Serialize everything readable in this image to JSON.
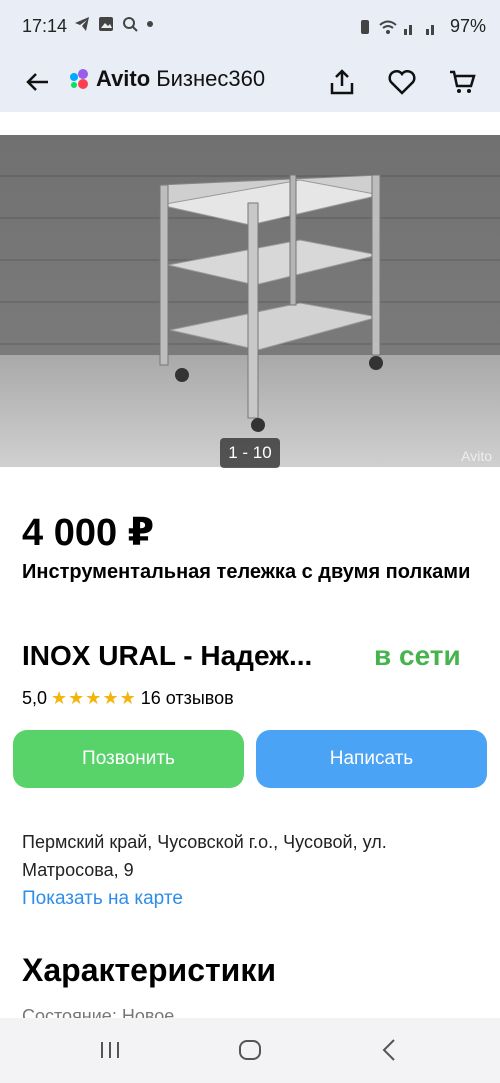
{
  "status": {
    "time": "17:14",
    "battery": "97%"
  },
  "header": {
    "brand_primary": "Avito",
    "brand_secondary": "Бизнес360"
  },
  "gallery": {
    "counter": "1 - 10",
    "watermark": "Avito"
  },
  "listing": {
    "price": "4 000 ₽",
    "title": "Инструментальная тележка с двумя полками"
  },
  "seller": {
    "name": "INOX URAL - Надеж...",
    "status": "в сети",
    "rating": "5,0",
    "reviews": "16 отзывов"
  },
  "actions": {
    "call": "Позвонить",
    "write": "Написать"
  },
  "location": {
    "address": "Пермский край, Чусовской г.о., Чусовой, ул. Матросова, 9",
    "map_link": "Показать на карте"
  },
  "specs": {
    "heading": "Характеристики",
    "partial_row": "Состояние: Новое"
  }
}
